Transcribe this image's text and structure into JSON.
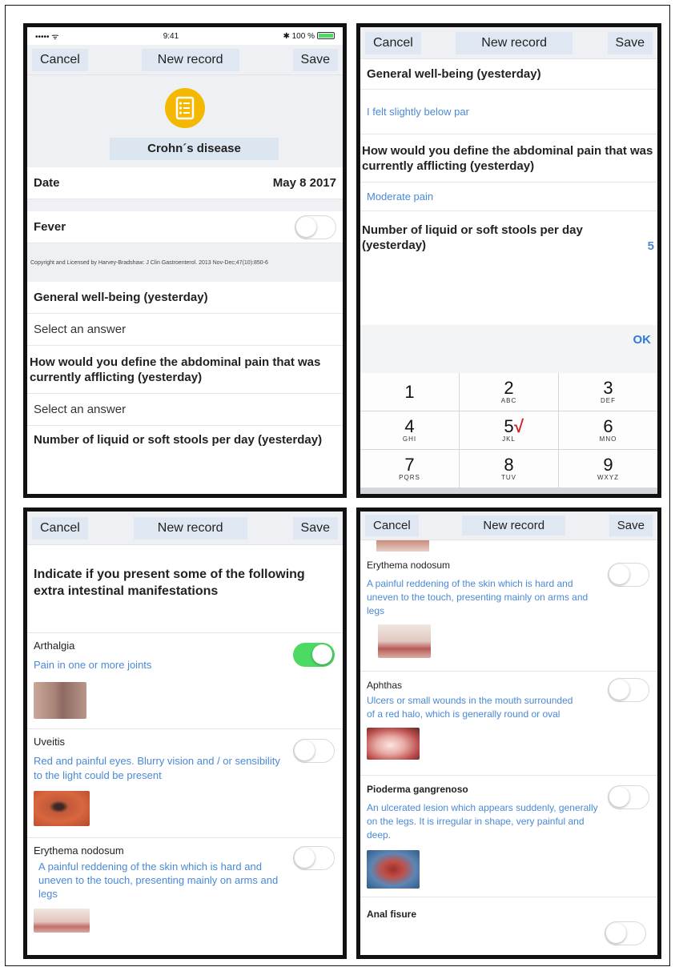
{
  "status": {
    "signal": "••••• ᯤ",
    "time": "9:41",
    "battery": "100 %"
  },
  "nav": {
    "cancel": "Cancel",
    "title": "New record",
    "save": "Save"
  },
  "screen1": {
    "disease": "Crohn´s disease",
    "date_label": "Date",
    "date_value": "May 8 2017",
    "fever_label": "Fever",
    "copyright": "Copyright and Licensed by Harvey-Bradshaw: J Clin Gastroenterol. 2013 Nov-Dec;47(10):850-6",
    "q1": "General well-being (yesterday)",
    "a1": "Select an answer",
    "q2": "How would you define the abdominal pain that was currently afflicting (yesterday)",
    "a2": "Select an answer",
    "q3": "Number of liquid or soft stools per day (yesterday)"
  },
  "screen2": {
    "q1": "General well-being (yesterday)",
    "a1": "I felt slightly below par",
    "q2": "How would you define the abdominal pain that was currently afflicting (yesterday)",
    "a2": "Moderate pain",
    "q3": "Number of liquid or soft stools per day (yesterday)",
    "a3": "5",
    "ok": "OK",
    "check": "√",
    "keys": [
      {
        "d": "1",
        "l": ""
      },
      {
        "d": "2",
        "l": "ABC"
      },
      {
        "d": "3",
        "l": "DEF"
      },
      {
        "d": "4",
        "l": "GHI"
      },
      {
        "d": "5",
        "l": "JKL"
      },
      {
        "d": "6",
        "l": "MNO"
      },
      {
        "d": "7",
        "l": "PQRS"
      },
      {
        "d": "8",
        "l": "TUV"
      },
      {
        "d": "9",
        "l": "WXYZ"
      }
    ]
  },
  "screen3": {
    "heading": "Indicate if you present some of the following extra intestinal manifestations",
    "items": [
      {
        "title": "Arthalgia",
        "desc": "Pain in one or more joints",
        "on": true
      },
      {
        "title": "Uveitis",
        "desc": "Red and painful eyes. Blurry vision and / or sensibility to the light could be present",
        "on": false
      },
      {
        "title": "Erythema nodosum",
        "desc": "A painful reddening of the skin which is hard and uneven to the touch, presenting mainly on arms and legs",
        "on": false
      }
    ]
  },
  "screen4": {
    "items": [
      {
        "title": "Erythema nodosum",
        "desc": "A painful reddening of the skin which is hard and uneven to the touch, presenting mainly on arms and legs",
        "on": false
      },
      {
        "title": "Aphthas",
        "desc": "Ulcers or small wounds in the mouth surrounded of a red halo, which is generally round or oval",
        "on": false
      },
      {
        "title": "Pioderma gangrenoso",
        "desc": "An ulcerated lesion which appears suddenly, generally on the legs. It is irregular in shape, very painful and deep.",
        "on": false
      }
    ],
    "last_title": "Anal fisure"
  },
  "colors": {
    "accent": "#4a89d6",
    "toggle_on": "#4cd964",
    "icon": "#f5b800",
    "check": "#d0202a"
  }
}
